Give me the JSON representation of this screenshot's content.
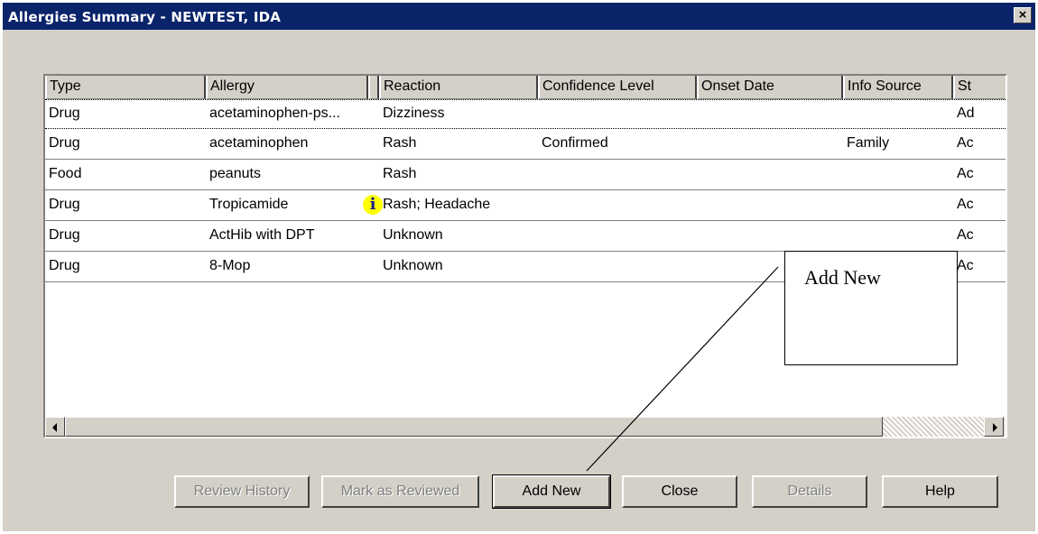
{
  "window": {
    "title": "Allergies Summary - NEWTEST, IDA",
    "close_label": "×"
  },
  "table": {
    "columns": [
      "Type",
      "Allergy",
      "",
      "Reaction",
      "Confidence Level",
      "Onset Date",
      "Info Source",
      "St"
    ],
    "rows": [
      {
        "type": "Drug",
        "allergy": "acetaminophen-ps...",
        "reaction": "Dizziness",
        "confidence": "",
        "onset": "",
        "source": "",
        "status": "Ad",
        "info": false,
        "focused": true
      },
      {
        "type": "Drug",
        "allergy": "acetaminophen",
        "reaction": "Rash",
        "confidence": "Confirmed",
        "onset": "",
        "source": "Family",
        "status": "Ac",
        "info": false,
        "focused": false
      },
      {
        "type": "Food",
        "allergy": "peanuts",
        "reaction": "Rash",
        "confidence": "",
        "onset": "",
        "source": "",
        "status": "Ac",
        "info": false,
        "focused": false
      },
      {
        "type": "Drug",
        "allergy": "Tropicamide",
        "reaction": "Rash; Headache",
        "confidence": "",
        "onset": "",
        "source": "",
        "status": "Ac",
        "info": true,
        "focused": false
      },
      {
        "type": "Drug",
        "allergy": "ActHib with DPT",
        "reaction": "Unknown",
        "confidence": "",
        "onset": "",
        "source": "",
        "status": "Ac",
        "info": false,
        "focused": false
      },
      {
        "type": "Drug",
        "allergy": "8-Mop",
        "reaction": "Unknown",
        "confidence": "",
        "onset": "",
        "source": "",
        "status": "Ac",
        "info": false,
        "focused": false
      }
    ],
    "info_icon_glyph": "i"
  },
  "buttons": {
    "review_history": "Review History",
    "mark_reviewed": "Mark as Reviewed",
    "add_new": "Add New",
    "close": "Close",
    "details": "Details",
    "help": "Help"
  },
  "callout": {
    "text": "Add New"
  },
  "colors": {
    "titlebar": "#0a246a",
    "face": "#d4d0c8",
    "info_icon": "#ffff00"
  }
}
